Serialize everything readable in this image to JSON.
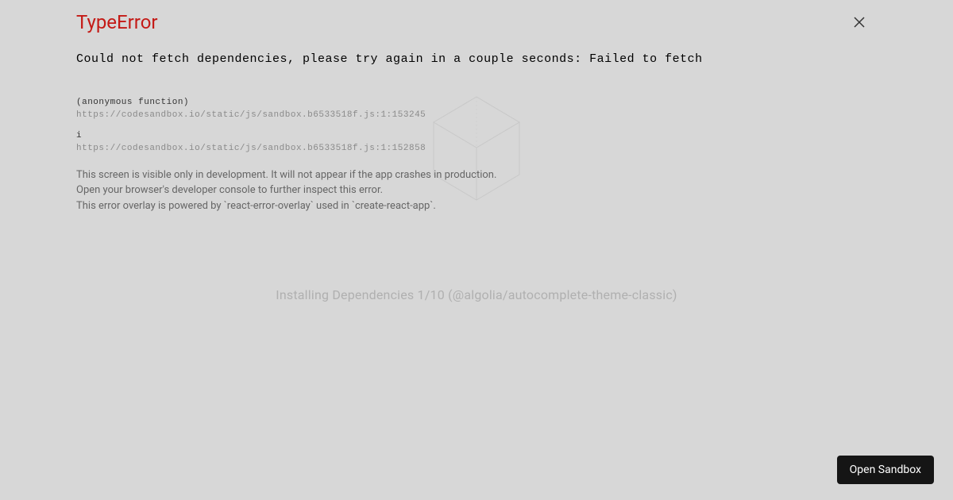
{
  "error": {
    "title": "TypeError",
    "message": "Could not fetch dependencies, please try again in a couple seconds: Failed to fetch"
  },
  "stack": [
    {
      "fn": "(anonymous function)",
      "url": "https://codesandbox.io/static/js/sandbox.b6533518f.js:1:153245"
    },
    {
      "fn": "i",
      "url": "https://codesandbox.io/static/js/sandbox.b6533518f.js:1:152858"
    }
  ],
  "info": {
    "line1": "This screen is visible only in development. It will not appear if the app crashes in production.",
    "line2": "Open your browser's developer console to further inspect this error.",
    "line3": "This error overlay is powered by `react-error-overlay` used in `create-react-app`."
  },
  "status": "Installing Dependencies 1/10 (@algolia/autocomplete-theme-classic)",
  "buttons": {
    "open_sandbox": "Open Sandbox"
  }
}
